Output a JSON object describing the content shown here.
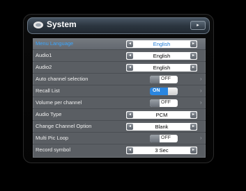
{
  "window": {
    "title": "System",
    "nav_icon": "right-arrow-icon",
    "nav_glyph": "▸"
  },
  "arrows": {
    "left": "◂",
    "right": "▸"
  },
  "chevron": "›",
  "colors": {
    "accent": "#2a86e0",
    "selected_text": "#3aa6ff",
    "menu_bg": "#5a5e63"
  },
  "menu": {
    "items": [
      {
        "label": "Menu Language",
        "type": "select",
        "value": "English",
        "selected": true
      },
      {
        "label": "Audio1",
        "type": "select",
        "value": "English"
      },
      {
        "label": "Audio2",
        "type": "select",
        "value": "English"
      },
      {
        "label": "Auto channel selection",
        "type": "toggle",
        "value": "OFF"
      },
      {
        "label": "Recall List",
        "type": "toggle",
        "value": "ON"
      },
      {
        "label": "Volume per channel",
        "type": "toggle",
        "value": "OFF"
      },
      {
        "label": "Audio Type",
        "type": "select",
        "value": "PCM"
      },
      {
        "label": "Change Channel Option",
        "type": "select",
        "value": "Blank"
      },
      {
        "label": "Multi Pic Loop",
        "type": "toggle",
        "value": "OFF"
      },
      {
        "label": "Record symbol",
        "type": "select",
        "value": "3 Sec"
      }
    ]
  }
}
